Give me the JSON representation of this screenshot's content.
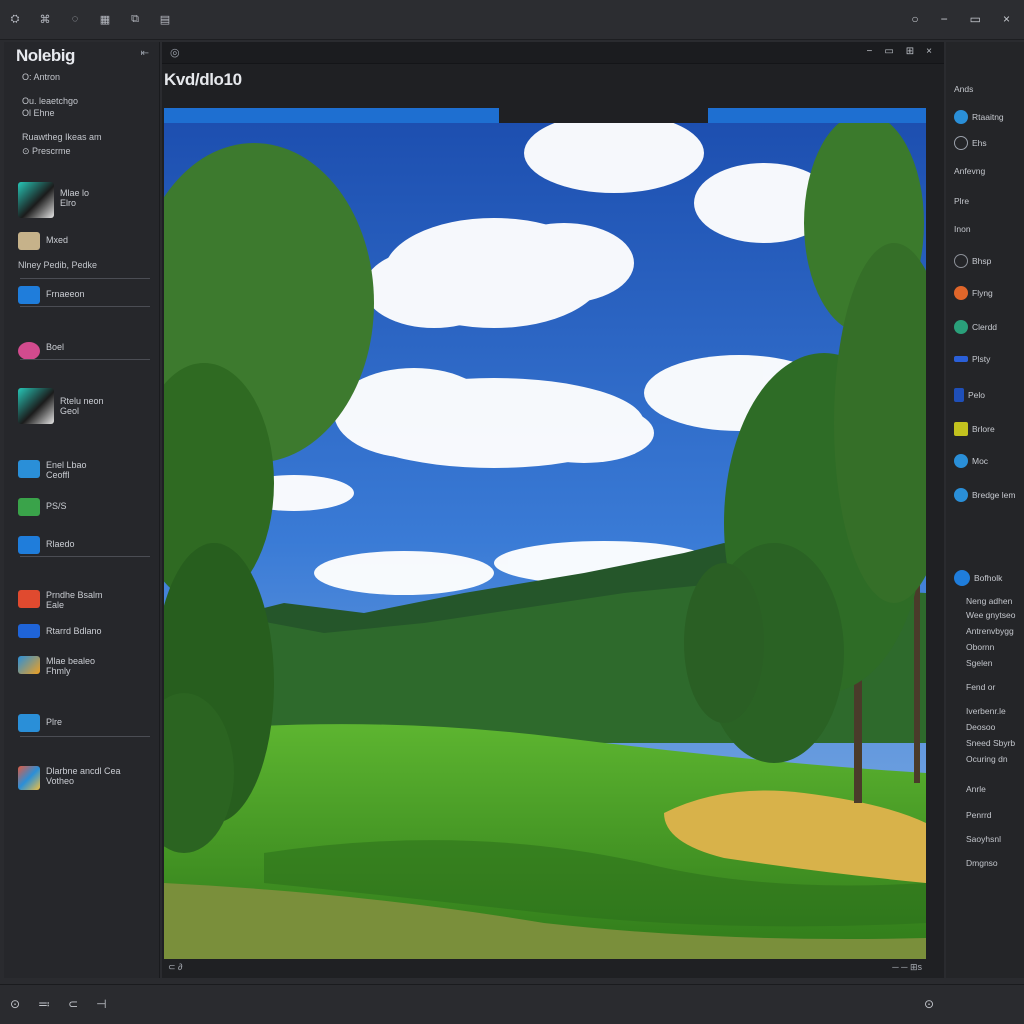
{
  "titlebar": {
    "menu_icons": [
      "tool-icon",
      "layers-icon",
      "brush-icon",
      "grid-icon",
      "crop-icon",
      "filter-icon"
    ],
    "menu_glyphs": [
      "⛭",
      "⌘",
      "◌",
      "▦",
      "⧉",
      "▤"
    ],
    "window_controls": [
      "○",
      "−",
      "▭",
      "×"
    ]
  },
  "sidebar": {
    "title": "Nolebig",
    "collapse": "⇤",
    "lines": [
      "O: Antron",
      "Ou. leaetchgo",
      "Ol Ehne",
      "Ruawtheg Ikeas am",
      "⊙ Prescrme"
    ],
    "items": [
      {
        "label": "Mlae lo\nElro",
        "color": "#27c7b8",
        "big": true
      },
      {
        "label": "Mxed",
        "color": "#c6b28a"
      },
      {
        "label": "Nlney Pedib, Pedke"
      },
      {
        "label": "Frnaeeon",
        "color": "#1f7ddb"
      },
      {
        "label": "Boel",
        "color": "#d24b8e"
      },
      {
        "label": "Rtelu neon\nGeol",
        "color": "#27c7b8",
        "big": true
      },
      {
        "label": "Enel Lbao\nCeoffl",
        "color": "#2a8fd8"
      },
      {
        "label": "PS/S",
        "color": "#3aa34a"
      },
      {
        "label": "Rlaedo",
        "color": "#1f7ddb"
      },
      {
        "label": "Prndhe Bsalm\nEale",
        "color": "#e04a2f"
      },
      {
        "label": "Rtarrd Bdlano",
        "color": "#1f64d8"
      },
      {
        "label": "Mlae bealeo\nFhmly",
        "color": "#f0a020"
      },
      {
        "label": "Plre",
        "color": "#2a8fd8"
      },
      {
        "label": "Dlarbne ancdl Cea\nVotheo",
        "color": "#e05a40"
      }
    ]
  },
  "main": {
    "left_icon": "◎",
    "right_controls": [
      "−",
      "▭",
      "⊞",
      "×"
    ],
    "doc_title": "Kvd/dlo10",
    "status_left": "⊂  ∂",
    "status_right": "─ ─ ⊞s"
  },
  "right_panel": {
    "items": [
      {
        "text": "Ands",
        "type": "label"
      },
      {
        "text": "Rtaaitng",
        "type": "icon",
        "color": "#2a8fd8"
      },
      {
        "text": "Ehs",
        "type": "icon",
        "color": "#9aa0aa"
      },
      {
        "text": "Anfevng",
        "type": "label"
      },
      {
        "text": "Plre",
        "type": "label"
      },
      {
        "text": "Inon",
        "type": "label"
      },
      {
        "text": "Bhsp",
        "type": "icon",
        "color": "#8d9199"
      },
      {
        "text": "Flyng",
        "type": "icon",
        "color": "#e0662a"
      },
      {
        "text": "Clerdd",
        "type": "icon",
        "color": "#2aa07a"
      },
      {
        "text": "Plsty",
        "type": "icon",
        "color": "#2a5fd8"
      },
      {
        "text": "Pelo",
        "type": "icon",
        "color": "#1f4fb8"
      },
      {
        "text": "Brlore",
        "type": "icon",
        "color": "#c2c21e"
      },
      {
        "text": "Moc",
        "type": "icon",
        "color": "#2a8fd8"
      },
      {
        "text": "Bredge lem",
        "type": "icon",
        "color": "#2a8fd8"
      },
      {
        "text": "Bofholk",
        "type": "icon",
        "color": "#1f7ddb"
      }
    ],
    "notes": [
      "Neng adhen",
      "Wee gnytseo",
      "Antrenvbygg",
      "Obornn",
      "Sgelen",
      "Fend or",
      "Iverbenr.le",
      "Deosoo",
      "Sneed Sbyrb",
      "Ocuring dn",
      "Anrle",
      "Penrrd",
      "Saoyhsnl",
      "Dmgnso"
    ]
  },
  "bottombar": {
    "left": [
      "⊙",
      "≕",
      "⊂",
      "⊣"
    ],
    "right": "⊙"
  },
  "colors": {
    "accent": "#1e6fd1",
    "sky": "#3a73c8",
    "grass": "#4caa2e"
  }
}
